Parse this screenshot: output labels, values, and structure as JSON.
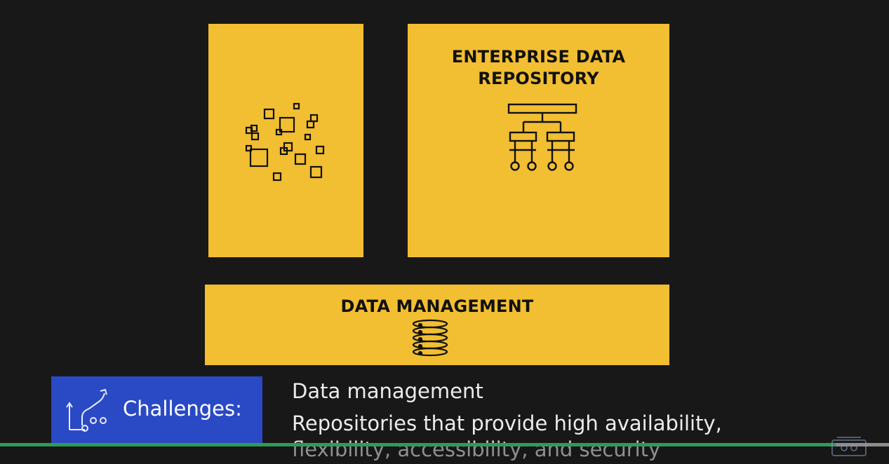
{
  "panels": {
    "enterprise_repository": {
      "title_line1": "ENTERPRISE DATA",
      "title_line2": "REPOSITORY"
    },
    "data_management": {
      "title": "DATA MANAGEMENT"
    }
  },
  "challenges": {
    "label": "Challenges:",
    "icon": "challenge-path-icon"
  },
  "caption": {
    "title": "Data management",
    "line1": "Repositories that provide high availability,",
    "line2": "flexibility, accessibility, and security"
  },
  "player": {
    "progress": 0.94
  },
  "icons": {
    "left_panel": "scattered-squares-icon",
    "right_panel": "hierarchy-tree-icon",
    "bottom_panel": "database-stack-icon",
    "watermark": "channel-logo-icon"
  },
  "colors": {
    "background": "#181818",
    "panel": "#f2be32",
    "challenges_box": "#2a49c4",
    "progress_played": "#2f9a57",
    "progress_track": "#8d8d8d"
  }
}
